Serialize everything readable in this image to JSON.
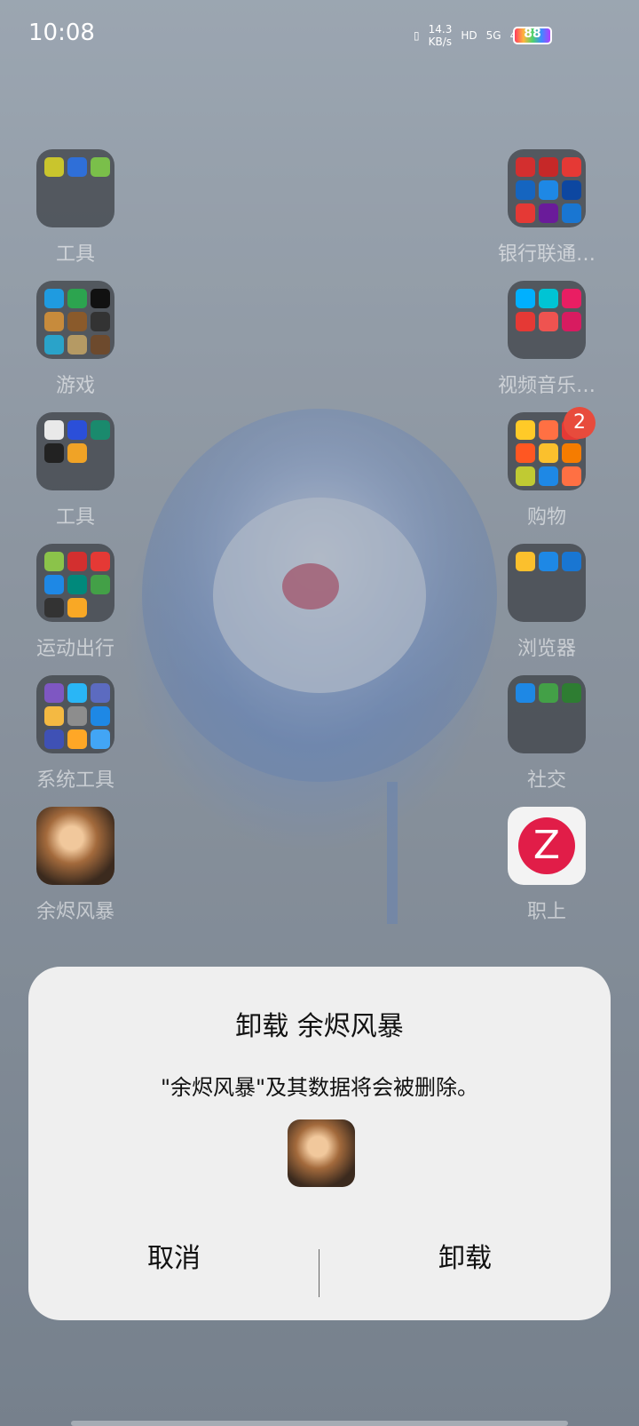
{
  "status_bar": {
    "time": "10:08",
    "net_speed": "14.3",
    "net_unit": "KB/s",
    "hd": "HD",
    "sim1": "5G",
    "sim2": "4G",
    "battery": "88"
  },
  "left_apps": [
    {
      "label": "工具"
    },
    {
      "label": "游戏"
    },
    {
      "label": "工具"
    },
    {
      "label": "运动出行"
    },
    {
      "label": "系统工具"
    },
    {
      "label": "余烬风暴"
    }
  ],
  "right_apps": [
    {
      "label": "银行联通…"
    },
    {
      "label": "视频音乐…"
    },
    {
      "label": "购物",
      "badge": "2"
    },
    {
      "label": "浏览器"
    },
    {
      "label": "社交"
    },
    {
      "label": "职上"
    }
  ],
  "dialog": {
    "title": "卸载 余烬风暴",
    "message": "\"余烬风暴\"及其数据将会被删除。",
    "cancel": "取消",
    "confirm": "卸载"
  },
  "colors": {
    "dialog_bg": "#efefef",
    "badge": "#e84b3c"
  }
}
